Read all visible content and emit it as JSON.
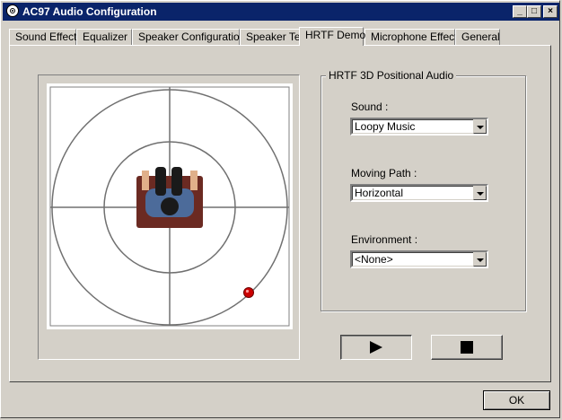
{
  "window": {
    "title": "AC97 Audio Configuration"
  },
  "titlebar_buttons": {
    "minimize": "_",
    "maximize": "□",
    "close": "×"
  },
  "tabs": [
    {
      "label": "Sound Effect"
    },
    {
      "label": "Equalizer"
    },
    {
      "label": "Speaker Configuration"
    },
    {
      "label": "Speaker Test"
    },
    {
      "label": "HRTF Demo",
      "active": true
    },
    {
      "label": "Microphone Effect"
    },
    {
      "label": "General"
    }
  ],
  "group": {
    "title": "HRTF 3D Positional Audio",
    "sound": {
      "label": "Sound :",
      "value": "Loopy Music"
    },
    "moving_path": {
      "label": "Moving Path :",
      "value": "Horizontal"
    },
    "environment": {
      "label": "Environment :",
      "value": "<None>"
    }
  },
  "footer": {
    "ok_label": "OK"
  },
  "colors": {
    "titlebar": "#0a246a",
    "face": "#d4d0c8",
    "sound_source": "#cc0000",
    "chair": "#6b2a22"
  },
  "icons": {
    "play": "play-icon",
    "stop": "stop-icon"
  }
}
